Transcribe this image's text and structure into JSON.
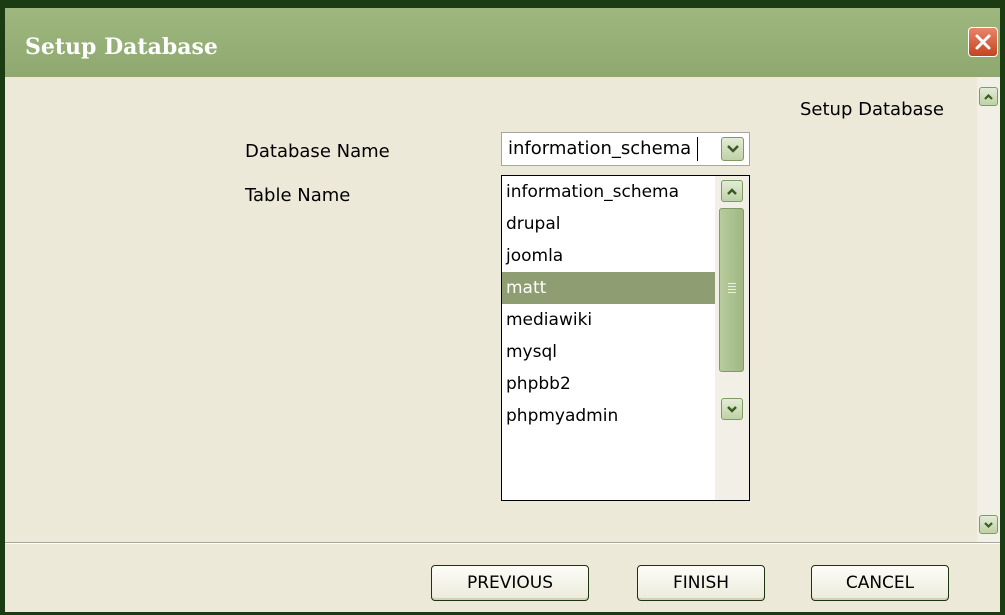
{
  "window": {
    "title": "Setup Database"
  },
  "panel": {
    "heading": "Setup Database"
  },
  "form": {
    "database_label": "Database Name",
    "table_label": "Table Name",
    "database_value": "information_schema"
  },
  "dropdown": {
    "selected_index": 3,
    "options": [
      "information_schema",
      "drupal",
      "joomla",
      "matt",
      "mediawiki",
      "mysql",
      "phpbb2",
      "phpmyadmin"
    ]
  },
  "footer": {
    "previous_label": "PREVIOUS",
    "finish_label": "FINISH",
    "cancel_label": "CANCEL"
  },
  "icons": {
    "close": "close-icon",
    "scroll_up": "chevron-up-icon",
    "scroll_down": "chevron-down-icon",
    "combo_arrow": "chevron-down-icon"
  },
  "colors": {
    "titlebar": "#8fa86f",
    "frame": "#1b3b12",
    "selection": "#8f9e72",
    "panel_bg": "#ece9d8"
  }
}
